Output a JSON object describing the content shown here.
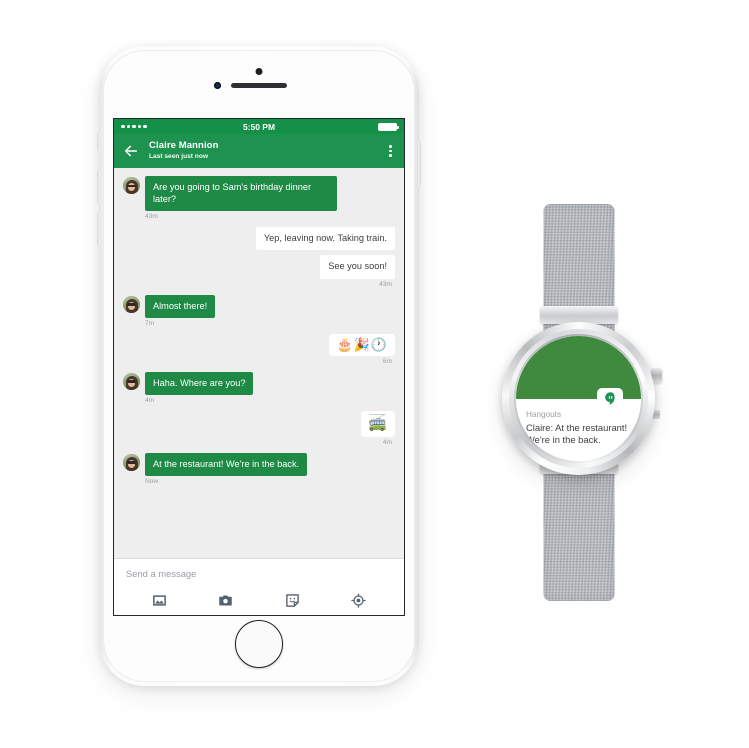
{
  "scene": {
    "background_color": "#ffffff",
    "devices": [
      "iphone",
      "android-wear-watch"
    ]
  },
  "phone": {
    "status_bar": {
      "carrier_signal_dots": 5,
      "time": "5:50 PM",
      "battery_icon": "battery-full-icon",
      "background_color": "#159048"
    },
    "app_bar": {
      "back_icon": "back-arrow-icon",
      "contact_name": "Claire Mannion",
      "contact_status": "Last seen just now",
      "overflow_icon": "overflow-menu-icon",
      "background_color": "#1e9350"
    },
    "conversation": [
      {
        "direction": "in",
        "kind": "text",
        "avatar": "contact-avatar",
        "text": "Are you going to Sam's birthday dinner later?",
        "timestamp": "43m"
      },
      {
        "direction": "out",
        "kind": "text",
        "text": "Yep, leaving now. Taking train.",
        "timestamp": ""
      },
      {
        "direction": "out",
        "kind": "text",
        "text": "See you soon!",
        "timestamp": "43m"
      },
      {
        "direction": "in",
        "kind": "text",
        "avatar": "contact-avatar",
        "text": "Almost there!",
        "timestamp": "7m"
      },
      {
        "direction": "out",
        "kind": "emoji",
        "text": "🎂🎉🕐",
        "timestamp": "6m"
      },
      {
        "direction": "in",
        "kind": "text",
        "avatar": "contact-avatar",
        "text": "Haha. Where are you?",
        "timestamp": "4m"
      },
      {
        "direction": "out",
        "kind": "emoji-single",
        "text": "🚎",
        "timestamp": "4m"
      },
      {
        "direction": "in",
        "kind": "text",
        "avatar": "contact-avatar",
        "text": "At the restaurant! We're in the back.",
        "timestamp": "Now"
      }
    ],
    "composer": {
      "placeholder": "Send a message",
      "tools": [
        {
          "name": "photo-icon",
          "label": "Photo"
        },
        {
          "name": "camera-icon",
          "label": "Camera"
        },
        {
          "name": "sticker-icon",
          "label": "Sticker"
        },
        {
          "name": "location-icon",
          "label": "Location"
        }
      ]
    },
    "colors": {
      "incoming_bubble": "#1e8a46",
      "outgoing_bubble": "#ffffff",
      "thread_background": "#eeeeee",
      "timestamp_text": "#9aa0a6"
    }
  },
  "watch": {
    "face_background_color": "#3f8a3f",
    "notification": {
      "app_name": "Hangouts",
      "app_icon": "hangouts-icon",
      "message": "Claire: At the restaurant! We're in the back."
    }
  }
}
